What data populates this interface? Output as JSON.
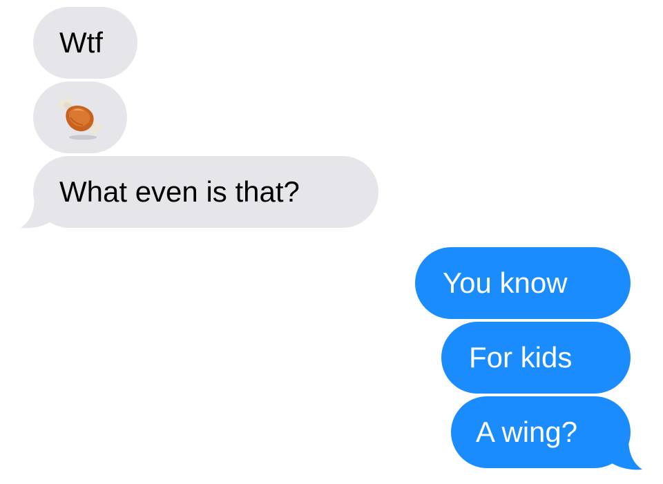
{
  "conversation": {
    "messages": [
      {
        "direction": "incoming",
        "text": "Wtf"
      },
      {
        "direction": "incoming",
        "emoji": "meat-on-bone",
        "text": ""
      },
      {
        "direction": "incoming",
        "text": "What even is that?"
      },
      {
        "direction": "outgoing",
        "text": "You know"
      },
      {
        "direction": "outgoing",
        "text": "For kids"
      },
      {
        "direction": "outgoing",
        "text": "A wing?"
      }
    ]
  },
  "colors": {
    "incoming_bubble": "#e5e5ea",
    "incoming_text": "#000000",
    "outgoing_bubble": "#1a8cfe",
    "outgoing_text": "#ffffff",
    "background": "#ffffff"
  }
}
